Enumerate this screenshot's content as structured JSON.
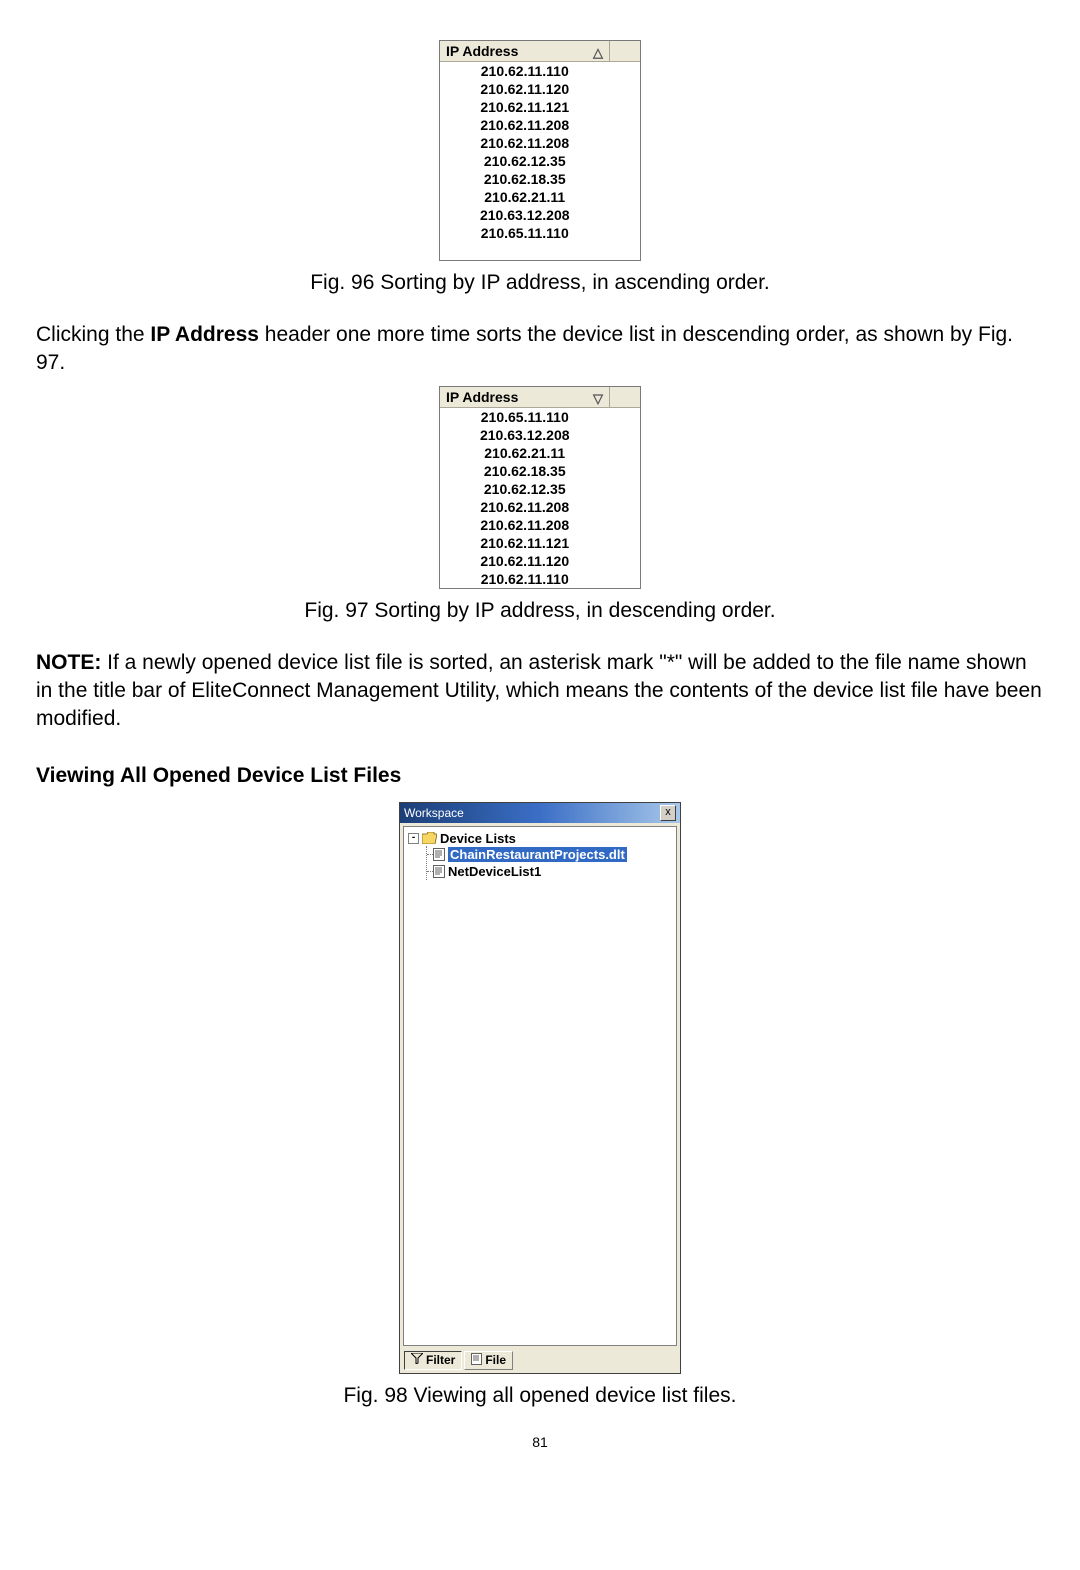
{
  "fig96": {
    "header": "IP Address",
    "rows": [
      "210.62.11.110",
      "210.62.11.120",
      "210.62.11.121",
      "210.62.11.208",
      "210.62.11.208",
      "210.62.12.35",
      "210.62.18.35",
      "210.62.21.11",
      "210.63.12.208",
      "210.65.11.110"
    ],
    "caption": "Fig. 96 Sorting by IP address, in ascending order."
  },
  "para1": {
    "prefix": "Clicking the ",
    "bold": "IP Address",
    "suffix": " header one more time sorts the device list in descending order, as shown by Fig. 97."
  },
  "fig97": {
    "header": "IP Address",
    "rows": [
      "210.65.11.110",
      "210.63.12.208",
      "210.62.21.11",
      "210.62.18.35",
      "210.62.12.35",
      "210.62.11.208",
      "210.62.11.208",
      "210.62.11.121",
      "210.62.11.120",
      "210.62.11.110"
    ],
    "caption": "Fig. 97 Sorting by IP address, in descending order."
  },
  "note": {
    "label": "NOTE:",
    "text": " If a newly opened device list file is sorted, an asterisk mark \"*\" will be added to the file name shown in the title bar of EliteConnect Management Utility, which means the contents of the device list file have been modified."
  },
  "section_heading": "Viewing All Opened Device List Files",
  "workspace": {
    "title": "Workspace",
    "close": "x",
    "root_label": "Device Lists",
    "toggle": "-",
    "items": [
      {
        "label": "ChainRestaurantProjects.dlt",
        "selected": true
      },
      {
        "label": "NetDeviceList1",
        "selected": false
      }
    ],
    "tabs": {
      "filter": "Filter",
      "file": "File"
    }
  },
  "fig98_caption": "Fig. 98 Viewing all opened device list files.",
  "page_number": "81"
}
